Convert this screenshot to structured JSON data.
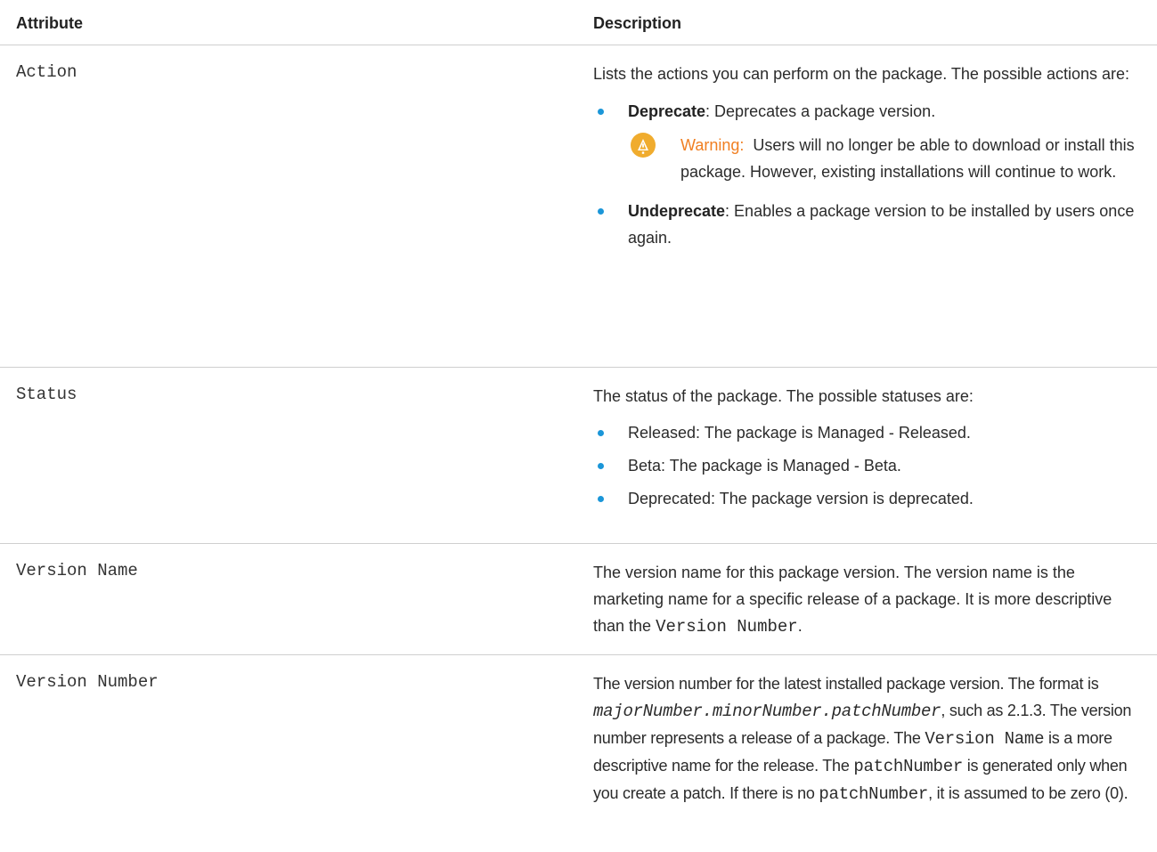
{
  "header": {
    "attribute": "Attribute",
    "description": "Description"
  },
  "rows": [
    {
      "name": "Action",
      "intro": "Lists the actions you can perform on the package. The possible actions are:",
      "deprecate": {
        "term": "Deprecate",
        "text": ": Deprecates a package version."
      },
      "warning": {
        "label": "Warning:",
        "text": "Users will no longer be able to download or install this package. However, existing installations will continue to work."
      },
      "undeprecate": {
        "term": "Undeprecate",
        "text": ": Enables a package version to be installed by users once again."
      }
    },
    {
      "name": "Status",
      "intro": "The status of the package. The possible statuses are:",
      "items": [
        "Released: The package is Managed - Released.",
        "Beta: The package is Managed - Beta.",
        "Deprecated: The package version is deprecated."
      ]
    },
    {
      "name": "Version Name",
      "text_before": "The version name for this package version. The version name is the marketing name for a specific release of a package. It is more descriptive than the ",
      "code": "Version Number",
      "text_after": "."
    },
    {
      "name": "Version Number",
      "t1": "The version number for the latest installed package version. The format is ",
      "format_code": "majorNumber.minorNumber.patchNumber",
      "t2": ", such as 2.1.3. The version number represents a release of a package. The ",
      "code_version_name": "Version Name",
      "t3": " is a more descriptive name for the release. The ",
      "code_patch_1": "patchNumber",
      "t4": " is generated only when you create a patch. If there is no ",
      "code_patch_2": "patchNumber",
      "t5": ", it is assumed to be zero (0)."
    }
  ],
  "colors": {
    "bullet": "#1b96d8",
    "warning_icon": "#f0ac2e",
    "warning_label": "#f07f22",
    "divider": "#cfcfcf"
  },
  "icons": {
    "warning": "warning-icon",
    "bullet": "bullet-dot"
  }
}
